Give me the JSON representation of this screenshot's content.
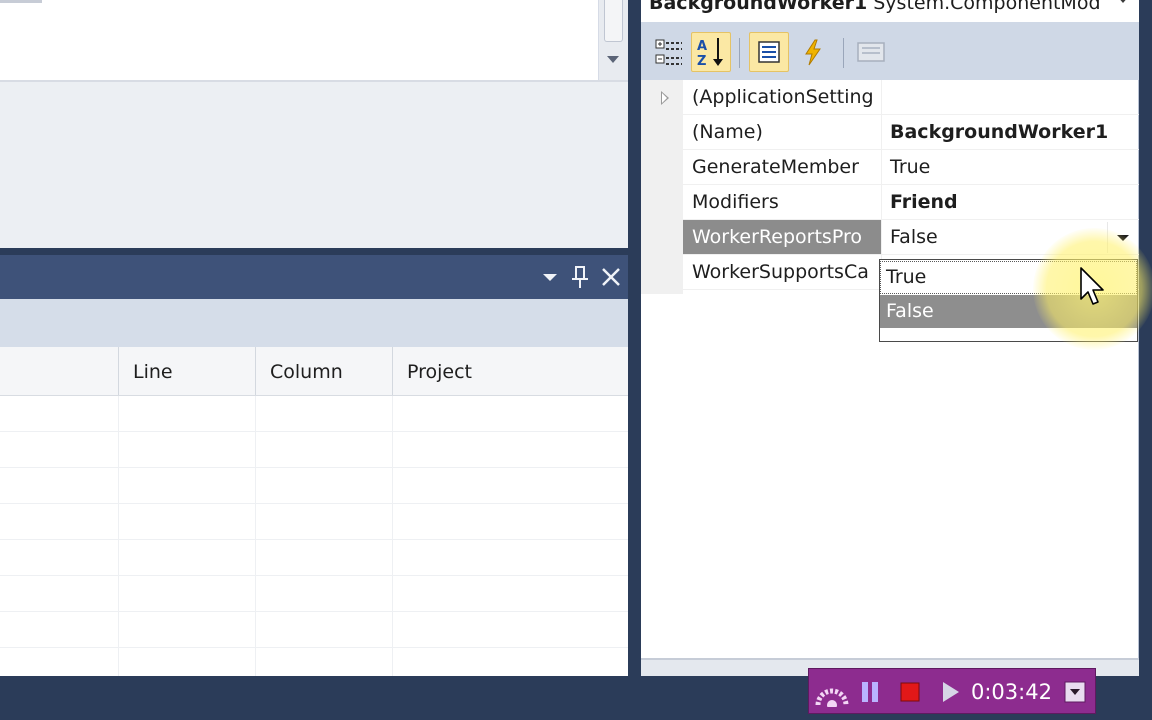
{
  "properties_window": {
    "object_selector": {
      "name": "BackgroundWorker1",
      "type": "System.ComponentMod"
    },
    "toolbar": {
      "categorized_icon": "categorized-icon",
      "alphabetical_icon": "alphabetical-sort-icon",
      "properties_icon": "properties-icon",
      "events_icon": "events-lightning-icon",
      "property_pages_icon": "property-pages-icon"
    },
    "rows": [
      {
        "name": "(ApplicationSetting",
        "value": ""
      },
      {
        "name": "(Name)",
        "value": "BackgroundWorker1"
      },
      {
        "name": "GenerateMember",
        "value": "True"
      },
      {
        "name": "Modifiers",
        "value": "Friend"
      },
      {
        "name": "WorkerReportsPro",
        "value": "False"
      },
      {
        "name": "WorkerSupportsCa",
        "value": ""
      }
    ],
    "dropdown_options": [
      "True",
      "False"
    ]
  },
  "error_list": {
    "columns": [
      "Line",
      "Column",
      "Project"
    ]
  },
  "recorder": {
    "elapsed": "0:03:42"
  },
  "colors": {
    "chrome_dark": "#2b3c59",
    "panel_title": "#3e5279",
    "selected_row": "#8c8c8c",
    "toolbar_active": "#fbe8a4",
    "recorder_bg": "#8d2c8f",
    "cursor_halo": "#fff078"
  }
}
